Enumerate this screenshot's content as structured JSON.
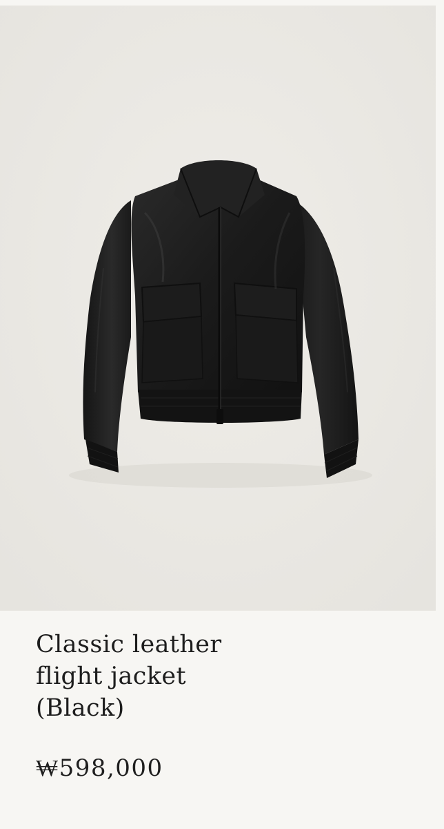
{
  "product": {
    "name_lines": [
      "Classic leather",
      "flight jacket",
      "(Black)"
    ],
    "price": "₩598,000",
    "image": {
      "subject": "jacket-photo",
      "colors": {
        "background": "#eae8e3",
        "leather": "#1d1d1d",
        "rib_knit": "#121212"
      }
    }
  }
}
